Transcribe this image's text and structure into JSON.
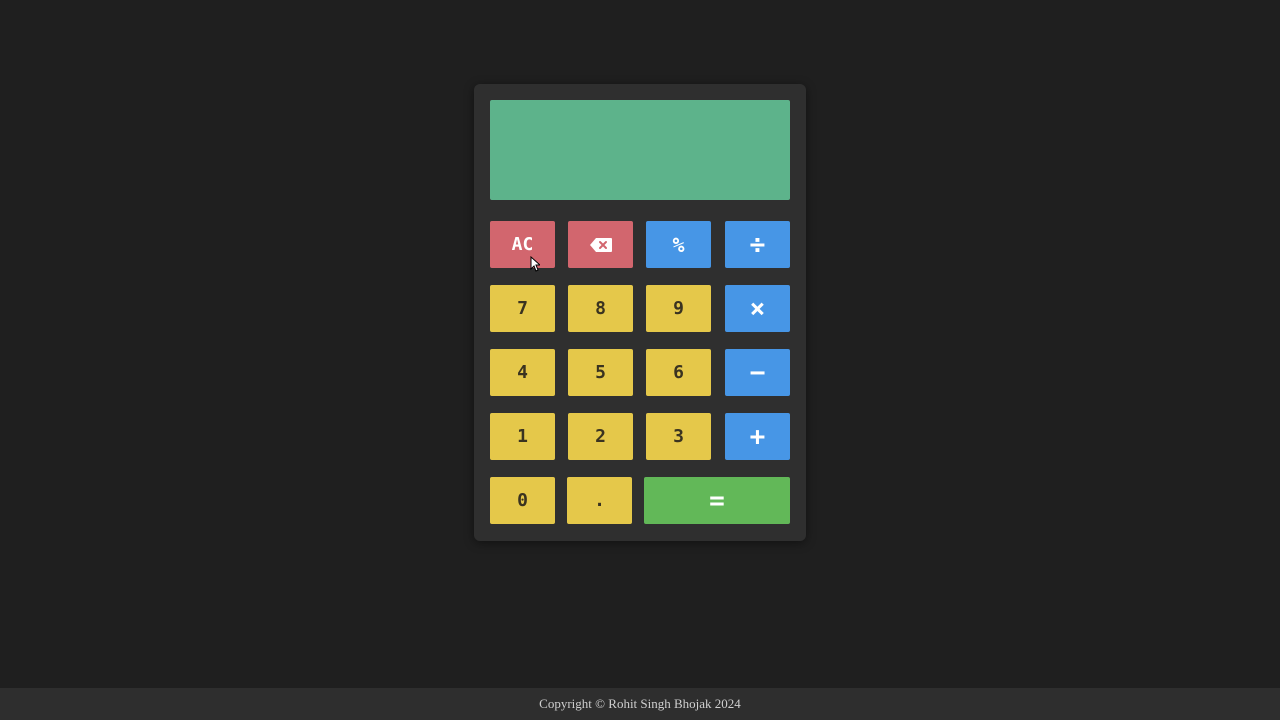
{
  "display": {
    "value": ""
  },
  "keys": {
    "clear": "AC",
    "backspace_icon": "backspace-icon",
    "percent": "%",
    "divide": "÷",
    "seven": "7",
    "eight": "8",
    "nine": "9",
    "multiply": "×",
    "four": "4",
    "five": "5",
    "six": "6",
    "subtract": "−",
    "one": "1",
    "two": "2",
    "three": "3",
    "add": "+",
    "zero": "0",
    "decimal": ".",
    "equals": "="
  },
  "colors": {
    "background": "#1f1f1f",
    "panel": "#2f2f2f",
    "display": "#5db38b",
    "number_key": "#e5c84a",
    "clear_key": "#d2666e",
    "operator_key": "#4796e6",
    "equals_key": "#62b858"
  },
  "footer": {
    "text": "Copyright © Rohit Singh Bhojak 2024"
  }
}
